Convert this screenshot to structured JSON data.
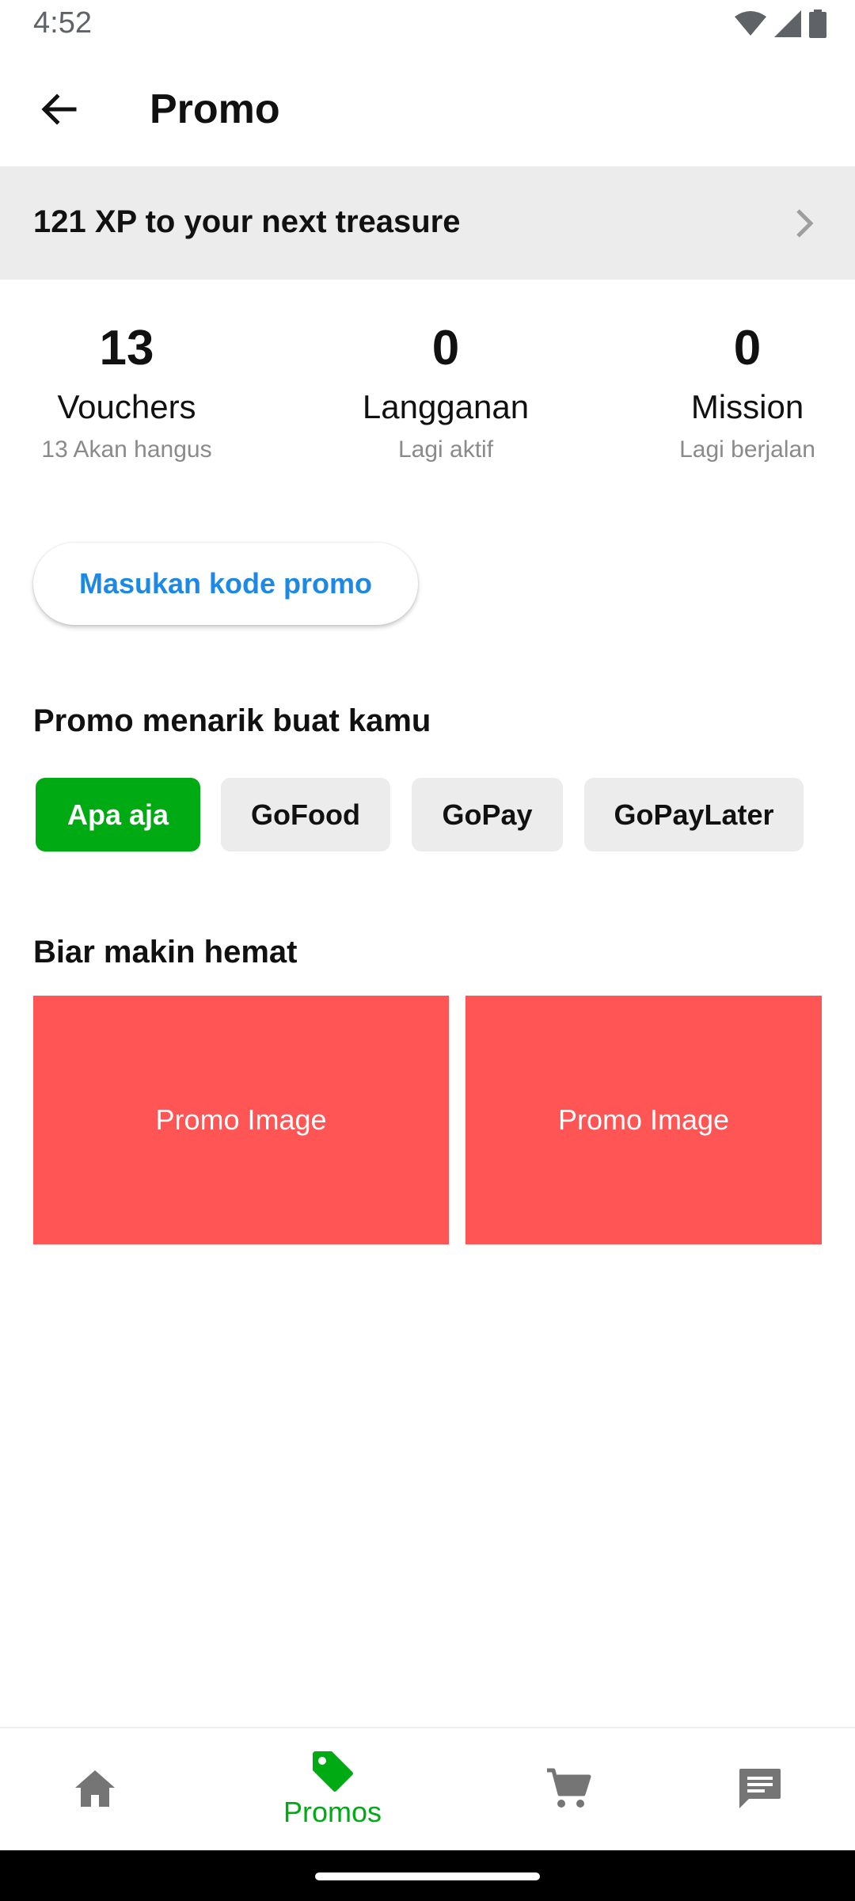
{
  "status_bar": {
    "time": "4:52"
  },
  "app_bar": {
    "title": "Promo"
  },
  "xp_banner": {
    "text": "121 XP to your next treasure"
  },
  "stats": [
    {
      "value": "13",
      "label": "Vouchers",
      "sub": "13 Akan hangus"
    },
    {
      "value": "0",
      "label": "Langganan",
      "sub": "Lagi aktif"
    },
    {
      "value": "0",
      "label": "Mission",
      "sub": "Lagi berjalan"
    }
  ],
  "promo_code_button": {
    "label": "Masukan kode promo"
  },
  "promo_section": {
    "title": "Promo menarik buat kamu",
    "chips": [
      "Apa aja",
      "GoFood",
      "GoPay",
      "GoPayLater"
    ],
    "active_chip": "Apa aja"
  },
  "savings_section": {
    "title": "Biar makin hemat",
    "images": [
      "Promo Image",
      "Promo Image"
    ]
  },
  "bottom_nav": {
    "items": [
      {
        "icon": "home-icon",
        "label": ""
      },
      {
        "icon": "tag-icon",
        "label": "Promos"
      },
      {
        "icon": "cart-icon",
        "label": ""
      },
      {
        "icon": "chat-icon",
        "label": ""
      }
    ],
    "active": "Promos"
  },
  "colors": {
    "accent_green": "#00aa13",
    "link_blue": "#1e88e5",
    "promo_red": "#ff5555",
    "banner_gray": "#ececec"
  }
}
